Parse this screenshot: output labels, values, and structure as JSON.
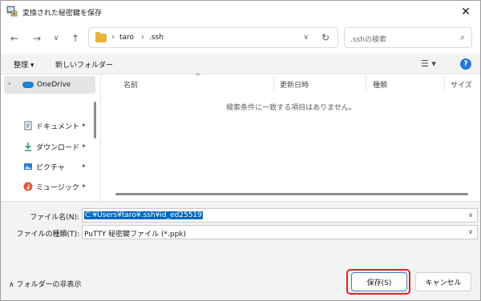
{
  "window": {
    "title": "変換された秘密鍵を保存",
    "close": "✕"
  },
  "nav": {
    "back": "←",
    "forward": "→",
    "recent": "∨",
    "up": "↑",
    "breadcrumbs": [
      "taro",
      ".ssh"
    ],
    "separator": "›",
    "dropdown": "∨",
    "refresh": "↻",
    "search_placeholder": ".sshの検索",
    "search_icon": "⌕"
  },
  "commands": {
    "organize": "整理 ▾",
    "new_folder": "新しいフォルダー",
    "view": "☰ ▾",
    "help": "?"
  },
  "sidebar": {
    "onedrive": "OneDrive",
    "quick_access": [
      {
        "label": "ドキュメント",
        "icon": "document-icon",
        "color": "#5a6b7b"
      },
      {
        "label": "ダウンロード",
        "icon": "download-icon",
        "color": "#1f8f5f"
      },
      {
        "label": "ピクチャ",
        "icon": "pictures-icon",
        "color": "#2a7fd4"
      },
      {
        "label": "ミュージック",
        "icon": "music-icon",
        "color": "#e05b3d"
      }
    ],
    "pin": "📌"
  },
  "filelist": {
    "columns": [
      "名前",
      "更新日時",
      "種類",
      "サイズ"
    ],
    "sort_caret": "^",
    "empty_message": "検索条件に一致する項目はありません。"
  },
  "form": {
    "filename_label": "ファイル名(N):",
    "filename_value": "C:¥Users¥taro¥.ssh¥id_ed25519",
    "filetype_label": "ファイルの種類(T):",
    "filetype_value": "PuTTY 秘密鍵ファイル (*.ppk)",
    "dropdown": "∨"
  },
  "footer": {
    "hide_folders": "∧  フォルダーの非表示",
    "save": "保存(S)",
    "cancel": "キャンセル"
  }
}
